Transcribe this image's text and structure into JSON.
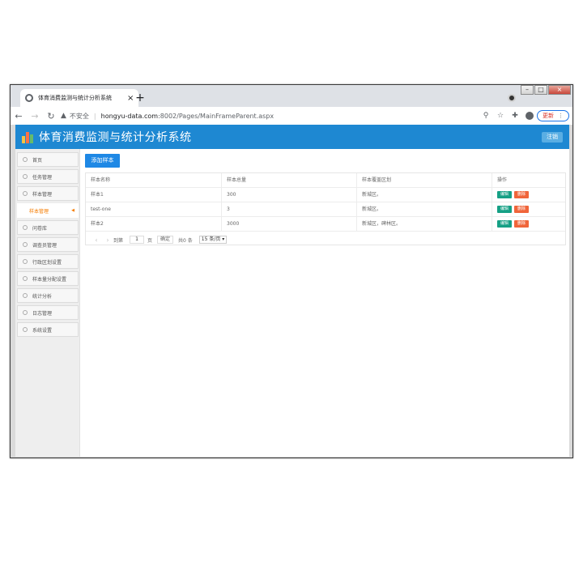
{
  "browser": {
    "tab_title": "体育消费监测与统计分析系统",
    "tab_close": "×",
    "new_tab": "+",
    "insecure_label": "不安全",
    "url_host": "hongyu-data.com",
    "url_path": ":8002/Pages/MainFrameParent.aspx",
    "update_label": "更新",
    "window_controls": {
      "minimize": "–",
      "maximize": "□",
      "close": "×"
    }
  },
  "app": {
    "title": "体育消费监测与统计分析系统",
    "logout_label": "注销",
    "header_color": "#1e88d2"
  },
  "sidebar": {
    "items": [
      {
        "label": "首页",
        "icon": "home-icon"
      },
      {
        "label": "任务管理",
        "icon": "task-icon"
      },
      {
        "label": "样本管理",
        "icon": "sample-icon"
      },
      {
        "label": "样本管理",
        "icon": "",
        "sub": true,
        "active": true
      },
      {
        "label": "问卷库",
        "icon": "survey-icon"
      },
      {
        "label": "调查员管理",
        "icon": "chart-icon"
      },
      {
        "label": "行政区划设置",
        "icon": "region-icon"
      },
      {
        "label": "样本量分配设置",
        "icon": "allocation-icon"
      },
      {
        "label": "统计分析",
        "icon": "stats-icon"
      },
      {
        "label": "日志管理",
        "icon": "log-icon"
      },
      {
        "label": "系统设置",
        "icon": "settings-icon"
      }
    ]
  },
  "main": {
    "add_button_label": "添加样本",
    "table": {
      "headers": [
        "样本名称",
        "样本总量",
        "样本覆盖区划",
        "操作"
      ],
      "rows": [
        {
          "name": "样本1",
          "total": "300",
          "region": "新城区。"
        },
        {
          "name": "test-one",
          "total": "3",
          "region": "新城区。"
        },
        {
          "name": "样本2",
          "total": "3000",
          "region": "新城区，碑林区。"
        }
      ],
      "edit_label": "编辑",
      "delete_label": "删除"
    },
    "pager": {
      "goto_label": "到第",
      "page_value": "1",
      "page_unit": "页",
      "confirm_label": "确定",
      "total_label": "共0 条",
      "page_size_label": "15 条/页"
    }
  }
}
